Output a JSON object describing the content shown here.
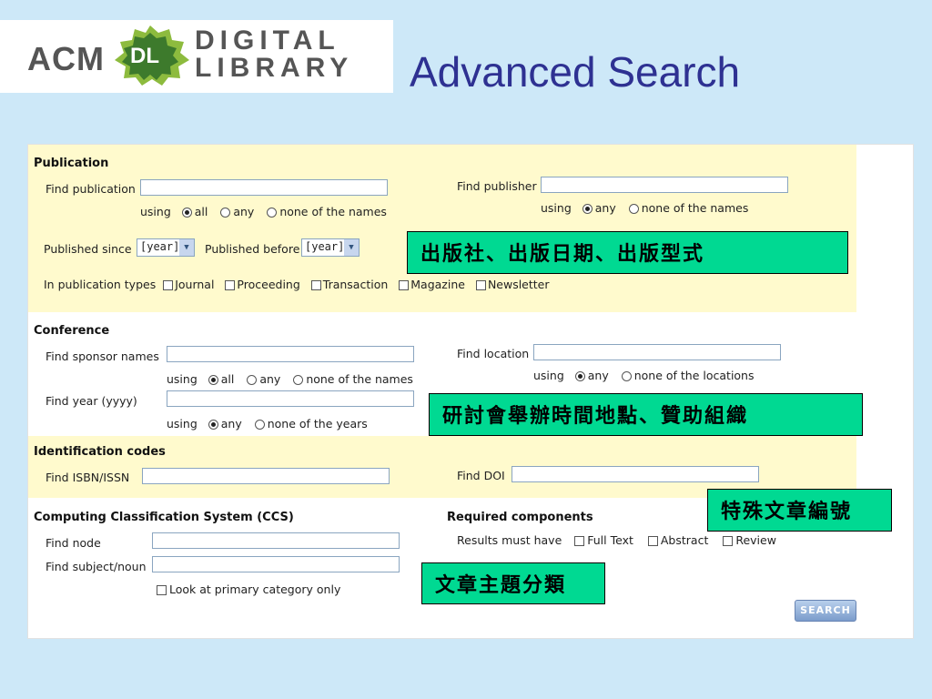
{
  "logo": {
    "acm": "ACM",
    "badge": "DL",
    "line1": "DIGITAL",
    "line2": "LIBRARY"
  },
  "title": "Advanced Search",
  "publication": {
    "header": "Publication",
    "find_publication": "Find publication",
    "using": "using",
    "opt_all": "all",
    "opt_any": "any",
    "opt_none_names": "none of the names",
    "find_publisher": "Find publisher",
    "published_since": "Published since",
    "published_before": "Published before",
    "year_placeholder": "[year]",
    "types_label": "In publication types",
    "types": [
      "Journal",
      "Proceeding",
      "Transaction",
      "Magazine",
      "Newsletter"
    ]
  },
  "conference": {
    "header": "Conference",
    "find_sponsor": "Find sponsor names",
    "find_location": "Find location",
    "find_year": "Find year (yyyy)",
    "opt_none_locations": "none of the locations",
    "opt_none_years": "none of the years"
  },
  "identification": {
    "header": "Identification codes",
    "find_isbn": "Find ISBN/ISSN",
    "find_doi": "Find DOI"
  },
  "ccs": {
    "header": "Computing Classification System (CCS)",
    "find_node": "Find node",
    "find_subject": "Find subject/noun",
    "primary_only": "Look at primary category only"
  },
  "required": {
    "header": "Required components",
    "label": "Results must have",
    "items": [
      "Full Text",
      "Abstract",
      "Review"
    ]
  },
  "search_button": "SEARCH",
  "annotations": {
    "publication": "出版社、出版日期、出版型式",
    "conference": "研討會舉辦時間地點、贊助組織",
    "codes": "特殊文章編號",
    "ccs": "文章主題分類"
  },
  "colors": {
    "title": "#2e3192",
    "background": "#cde8f8",
    "band": "#fffacd",
    "annotation": "#00d992"
  }
}
